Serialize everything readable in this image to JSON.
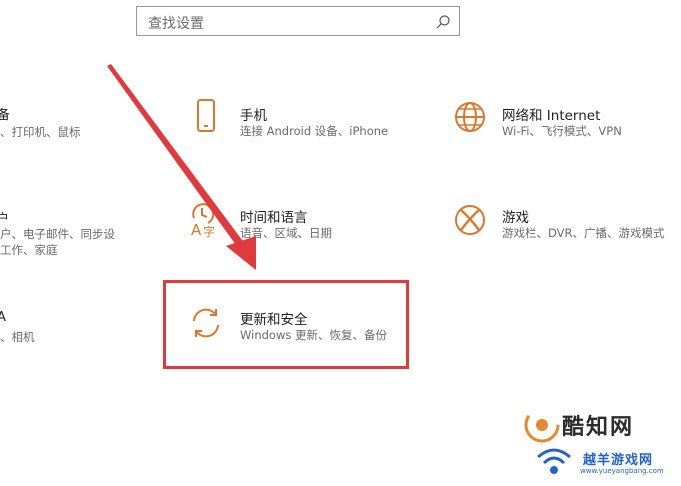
{
  "search": {
    "placeholder": "查找设置",
    "icon": "search-icon"
  },
  "left_column": [
    {
      "title": "备",
      "desc_lines": [
        "、打印机、鼠标"
      ]
    },
    {
      "title": "户",
      "desc_lines": [
        "户、电子邮件、同步设",
        "工作、家庭"
      ]
    },
    {
      "title": "A",
      "desc_lines": [
        "、相机"
      ]
    }
  ],
  "tiles": [
    {
      "key": "phone",
      "title": "手机",
      "desc": "连接 Android 设备、iPhone",
      "icon": "phone-icon"
    },
    {
      "key": "network",
      "title": "网络和 Internet",
      "desc": "Wi-Fi、飞行模式、VPN",
      "icon": "globe-icon"
    },
    {
      "key": "time",
      "title": "时间和语言",
      "desc": "语音、区域、日期",
      "icon": "time-language-icon"
    },
    {
      "key": "gaming",
      "title": "游戏",
      "desc": "游戏栏、DVR、广播、游戏模式",
      "icon": "xbox-icon"
    },
    {
      "key": "update",
      "title": "更新和安全",
      "desc": "Windows 更新、恢复、备份",
      "icon": "refresh-icon"
    }
  ],
  "colors": {
    "accent": "#d9782b",
    "highlight": "#e0393e",
    "watermark_blue": "#2563c9"
  },
  "watermark": {
    "name": "酷知网",
    "sub": "越羊游戏网",
    "url": "www.yueyangbang.com"
  }
}
